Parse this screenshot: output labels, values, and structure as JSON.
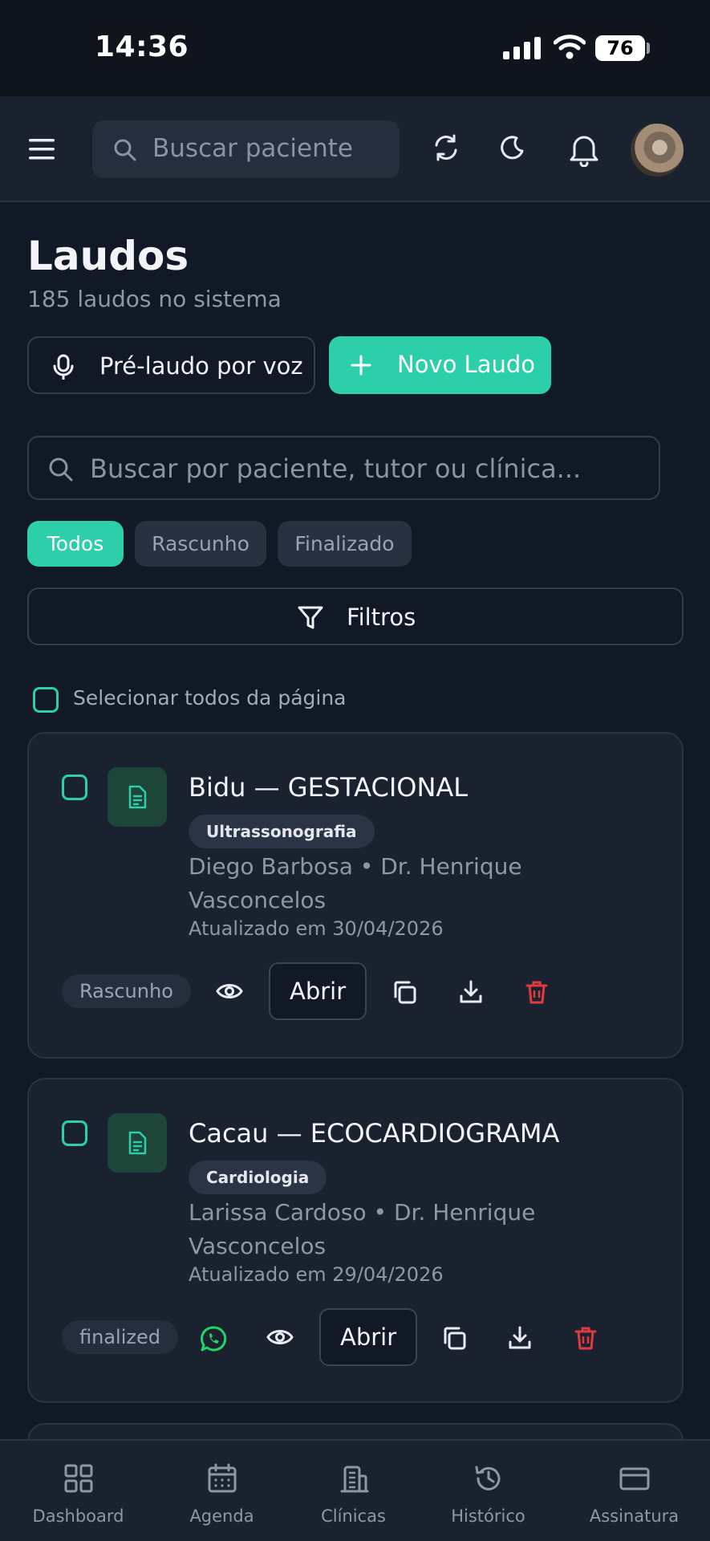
{
  "status_bar": {
    "time": "14:36",
    "battery": "76"
  },
  "header": {
    "search_placeholder": "Buscar paciente"
  },
  "page": {
    "title": "Laudos",
    "subtitle": "185 laudos no sistema",
    "voice_button": "Pré-laudo por voz",
    "new_button": "Novo Laudo",
    "search_placeholder": "Buscar por paciente, tutor ou clínica...",
    "filter_chips": [
      "Todos",
      "Rascunho",
      "Finalizado"
    ],
    "active_chip": "Todos",
    "filters_button": "Filtros",
    "select_all_label": "Selecionar todos da página"
  },
  "reports": [
    {
      "title": "Bidu — GESTACIONAL",
      "tag": "Ultrassonografia",
      "meta": "Diego Barbosa • Dr. Henrique Vasconcelos",
      "date": "Atualizado em 30/04/2026",
      "status": "Rascunho",
      "open_label": "Abrir",
      "has_whatsapp": false
    },
    {
      "title": "Cacau — ECOCARDIOGRAMA",
      "tag": "Cardiologia",
      "meta": "Larissa Cardoso • Dr. Henrique Vasconcelos",
      "date": "Atualizado em 29/04/2026",
      "status": "finalized",
      "open_label": "Abrir",
      "has_whatsapp": true
    }
  ],
  "bottom_nav": [
    {
      "label": "Dashboard",
      "icon": "dashboard-icon"
    },
    {
      "label": "Agenda",
      "icon": "calendar-icon"
    },
    {
      "label": "Clínicas",
      "icon": "building-icon"
    },
    {
      "label": "Histórico",
      "icon": "history-icon"
    },
    {
      "label": "Assinatura",
      "icon": "credit-card-icon"
    }
  ],
  "colors": {
    "accent": "#2ccfa9",
    "background": "#111826",
    "card": "#1a2230",
    "danger": "#e0393e",
    "whatsapp": "#25d366"
  }
}
